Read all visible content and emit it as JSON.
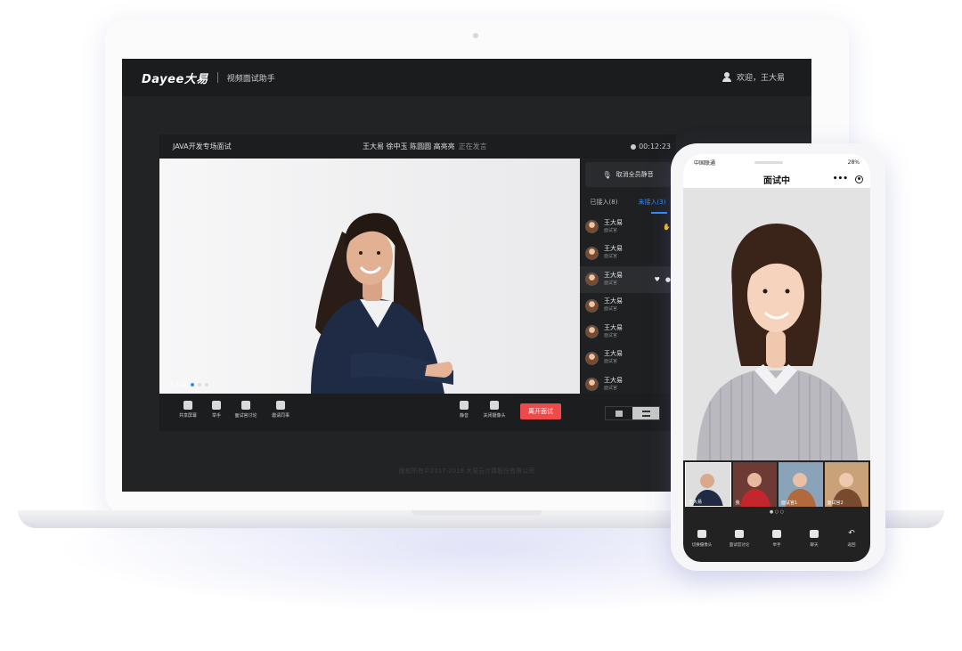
{
  "app": {
    "logo": "Dayee大易",
    "title": "视频面试助手",
    "welcome": "欢迎，王大易"
  },
  "meeting": {
    "title": "JAVA开发专场面试",
    "participants_line": "王大易 徐中玉 陈圆圆 高亮亮",
    "speaking_label": "正在发言",
    "timer": "00:12:23",
    "video_label": "王大易"
  },
  "sidebar": {
    "mute_all": "取消全员静音",
    "tabs": [
      {
        "label": "已接入(8)",
        "active": false
      },
      {
        "label": "未接入(3)",
        "active": true
      }
    ],
    "participants": [
      {
        "name": "王大易",
        "role": "面试官"
      },
      {
        "name": "王大易",
        "role": "面试官"
      },
      {
        "name": "王大易",
        "role": "面试官"
      },
      {
        "name": "王大易",
        "role": "面试官"
      },
      {
        "name": "王大易",
        "role": "面试官"
      },
      {
        "name": "王大易",
        "role": "面试官"
      },
      {
        "name": "王大易",
        "role": "面试官"
      }
    ]
  },
  "controls": {
    "share_screen": "共享屏幕",
    "raise_hand": "举手",
    "discussion": "面试官讨论",
    "invite": "邀请同事",
    "mute": "静音",
    "camera_off": "关闭摄像头",
    "leave": "离开面试"
  },
  "footer": {
    "copyright": "版权所有©2017-2018 大易云计算股份有限公司"
  },
  "phone": {
    "carrier": "中国联通",
    "battery": "28%",
    "title": "面试中",
    "thumbs": [
      {
        "label": "王大易"
      },
      {
        "label": "我"
      },
      {
        "label": "面试官1"
      },
      {
        "label": "面试官2"
      }
    ],
    "controls": {
      "switch_camera": "切换摄像头",
      "discussion": "面试官讨论",
      "raise_hand": "举手",
      "chat": "聊天",
      "back": "返回"
    }
  }
}
